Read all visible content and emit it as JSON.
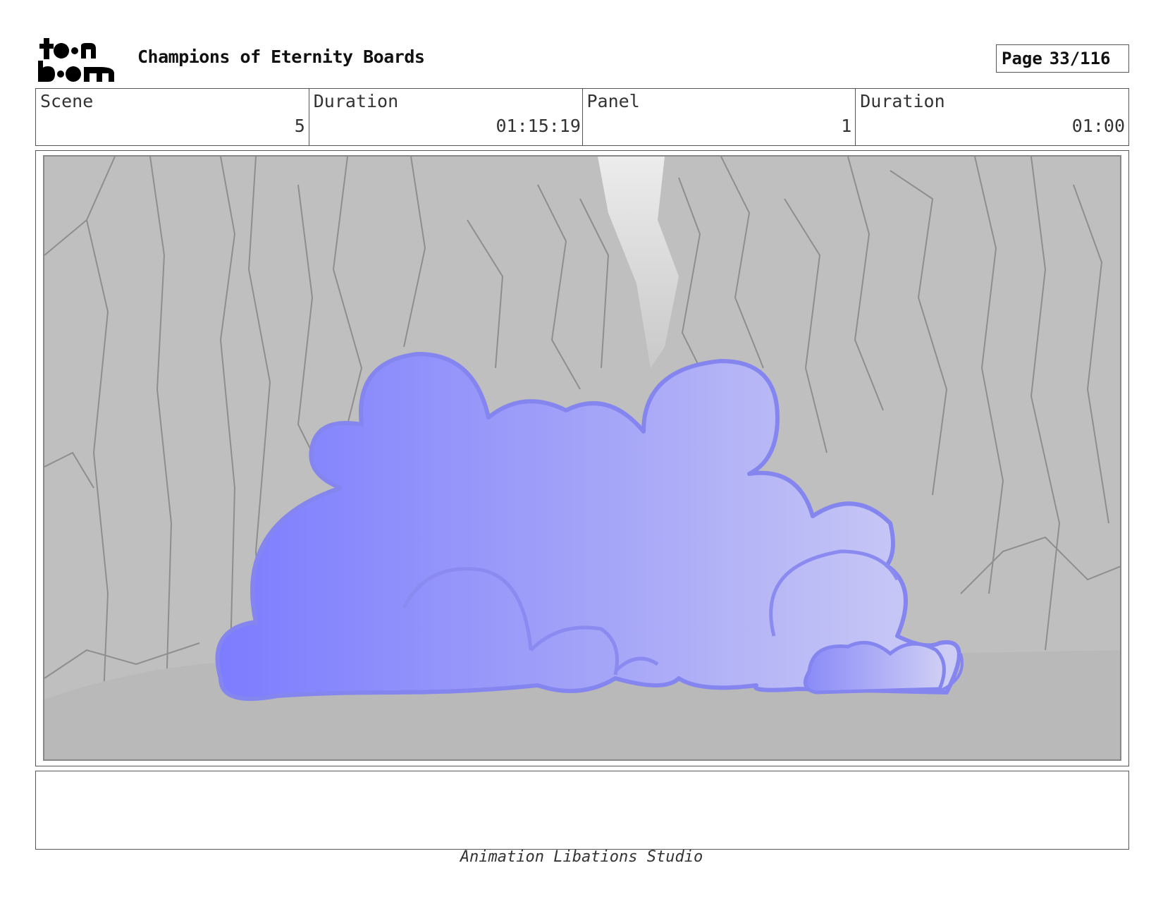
{
  "header": {
    "logo_text": "toon boom",
    "title": "Champions of Eternity Boards",
    "page_label": "Page",
    "page_number": "33/116"
  },
  "info": {
    "scene_label": "Scene",
    "scene_value": "5",
    "scene_duration_label": "Duration",
    "scene_duration_value": "01:15:19",
    "panel_label": "Panel",
    "panel_value": "1",
    "panel_duration_label": "Duration",
    "panel_duration_value": "01:00"
  },
  "panel_image": {
    "content": "canyon-with-purple-smoke-cloud",
    "colors": {
      "background": "#bdbdbd",
      "cloud_dark": "#7f7fff",
      "cloud_light": "#c8c8f6",
      "outline": "#8a8af0"
    }
  },
  "notes": {
    "text": ""
  },
  "footer": {
    "studio": "Animation Libations Studio"
  }
}
